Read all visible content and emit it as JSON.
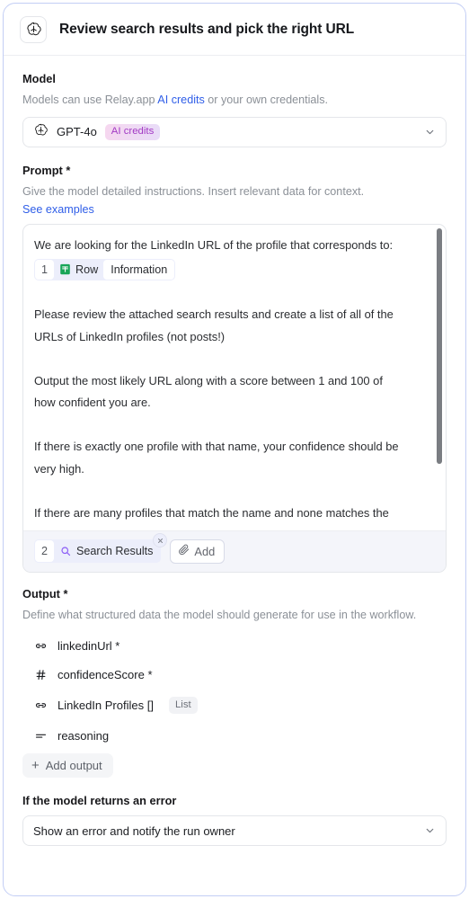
{
  "header": {
    "icon": "openai-logo-icon",
    "title": "Review search results and pick the right URL"
  },
  "model": {
    "label": "Model",
    "help_prefix": "Models can use Relay.app ",
    "help_link": "AI credits",
    "help_suffix": " or your own credentials.",
    "selected": "GPT-4o",
    "badge": "AI credits",
    "badge_color": "#a23ac4",
    "badge_bg": "#f2daf4"
  },
  "prompt": {
    "label": "Prompt *",
    "help": "Give the model detailed instructions. Insert relevant data for context.",
    "examples_link": "See examples",
    "lines": [
      "We are looking for the LinkedIn URL of the profile that corresponds to:"
    ],
    "chip": {
      "num": "1",
      "icon": "google-sheets-icon",
      "source": "Row",
      "field": "Information"
    },
    "body_lines": [
      "Please review the attached search results and create a list of all of the",
      "URLs of LinkedIn profiles (not posts!)",
      "",
      " Output the most likely URL along with a score between 1 and 100 of",
      "how confident you are.",
      "",
      "If there is exactly one profile with that name, your confidence should be",
      "very high.",
      "",
      "If there are many profiles that match the name and none matches the"
    ],
    "attachment": {
      "num": "2",
      "icon": "search-icon",
      "label": "Search Results",
      "close_icon": "close-icon"
    },
    "add_button": {
      "icon": "paperclip-icon",
      "label": "Add"
    }
  },
  "output": {
    "label": "Output *",
    "help": "Define what structured data the model should generate for use in the workflow.",
    "fields": [
      {
        "icon": "link-icon",
        "name": "linkedinUrl *",
        "badge": ""
      },
      {
        "icon": "hash-icon",
        "name": "confidenceScore *",
        "badge": ""
      },
      {
        "icon": "link-icon",
        "name": "LinkedIn Profiles []",
        "badge": "List"
      },
      {
        "icon": "text-lines-icon",
        "name": "reasoning",
        "badge": ""
      }
    ],
    "add_output": {
      "icon": "plus-icon",
      "label": "Add output"
    }
  },
  "error_handling": {
    "label": "If the model returns an error",
    "selected": "Show an error and notify the run owner"
  }
}
